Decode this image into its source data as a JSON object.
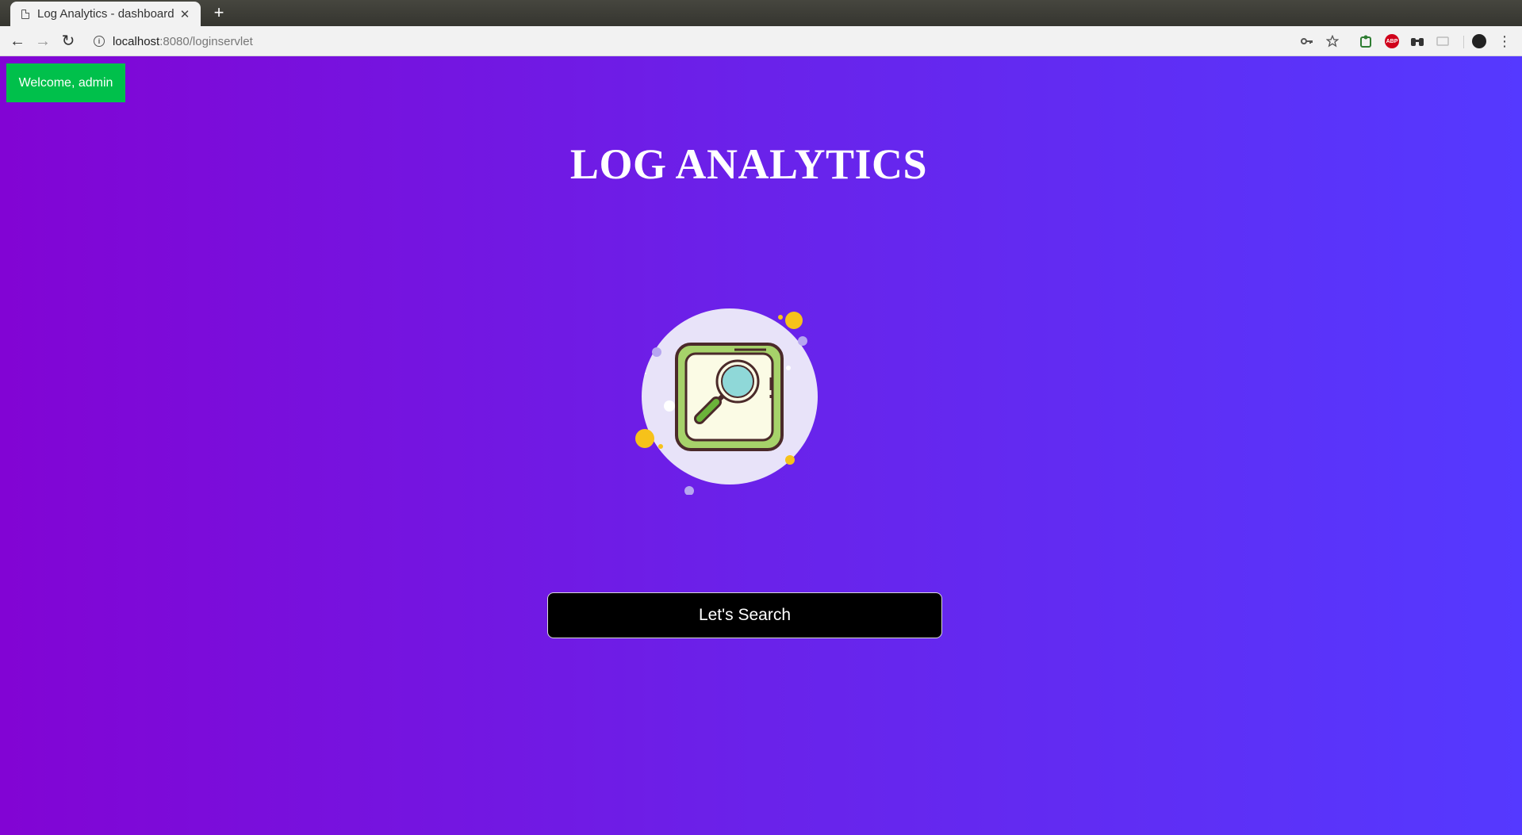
{
  "browser": {
    "tab_title": "Log Analytics - dashboard",
    "tab_close_glyph": "✕",
    "new_tab_glyph": "+",
    "url_host": "localhost",
    "url_rest": ":8080/loginservlet",
    "back_glyph": "←",
    "forward_glyph": "→",
    "reload_glyph": "↻",
    "icons": [
      "key-icon",
      "star-icon",
      "extension-icon",
      "adblock-icon",
      "binoculars-icon",
      "cast-icon",
      "profile-avatar",
      "menu-icon"
    ],
    "abp_label": "ABP",
    "menu_glyph": "⋮"
  },
  "page": {
    "welcome": "Welcome, admin",
    "heading": "LOG ANALYTICS",
    "search_button": "Let's Search"
  },
  "colors": {
    "gradient_start": "#8204d4",
    "gradient_end": "#5539ff",
    "welcome_bg": "#00c04b",
    "button_bg": "#000000"
  }
}
